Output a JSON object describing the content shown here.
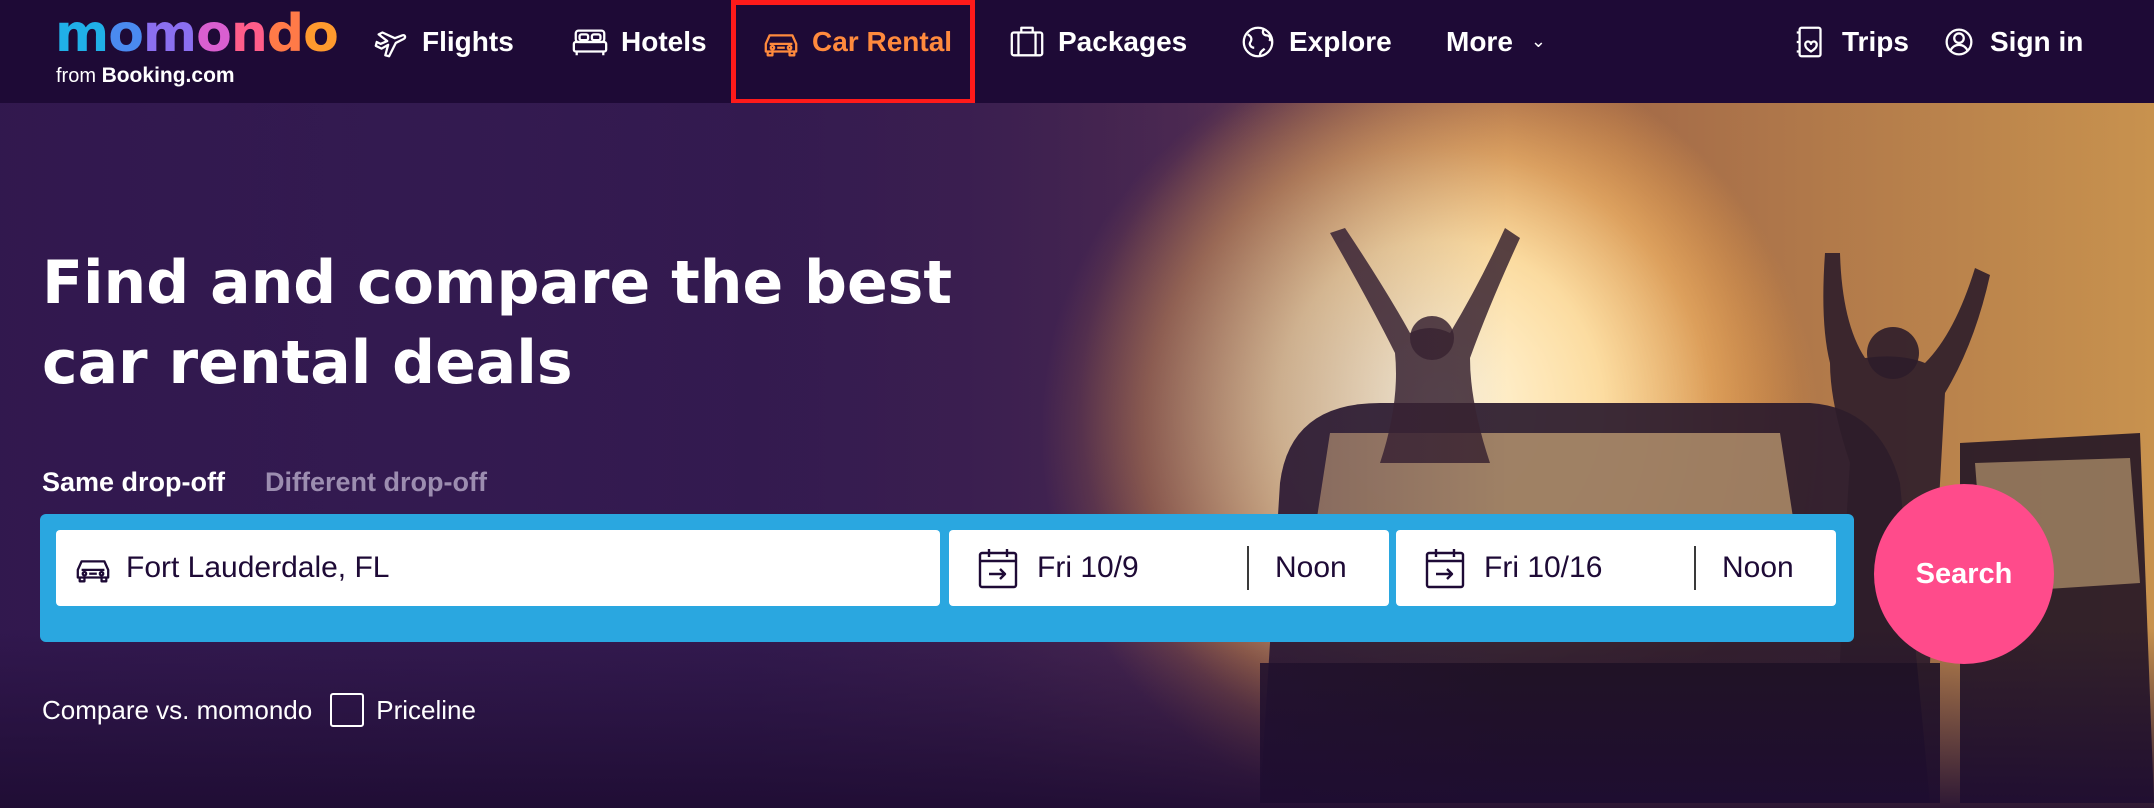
{
  "logo": {
    "word": [
      "m",
      "o",
      "m",
      "o",
      "n",
      "d",
      "o"
    ],
    "sub_prefix": "from",
    "sub_brand": "Booking.com"
  },
  "nav": {
    "items": [
      {
        "label": "Flights",
        "icon": "plane-icon"
      },
      {
        "label": "Hotels",
        "icon": "bed-icon"
      },
      {
        "label": "Car Rental",
        "icon": "car-icon",
        "active": true
      },
      {
        "label": "Packages",
        "icon": "suitcase-icon"
      },
      {
        "label": "Explore",
        "icon": "globe-icon"
      },
      {
        "label": "More",
        "icon": "chevron-down-icon"
      }
    ],
    "trips": "Trips",
    "sign_in": "Sign in"
  },
  "hero": {
    "headline": "Find and compare the best car rental deals",
    "tabs": {
      "same": "Same drop-off",
      "different": "Different drop-off"
    }
  },
  "search": {
    "location": "Fort Lauderdale, FL",
    "pickup_date": "Fri 10/9",
    "pickup_time": "Noon",
    "dropoff_date": "Fri 10/16",
    "dropoff_time": "Noon",
    "button": "Search"
  },
  "compare": {
    "label": "Compare vs. momondo",
    "option": "Priceline",
    "checked": false
  },
  "colors": {
    "nav_bg": "#1e0a36",
    "active_nav": "#ff8a3d",
    "search_bar": "#2aa7e0",
    "search_button": "#ff4b8b",
    "highlight": "#ff1a1a"
  }
}
